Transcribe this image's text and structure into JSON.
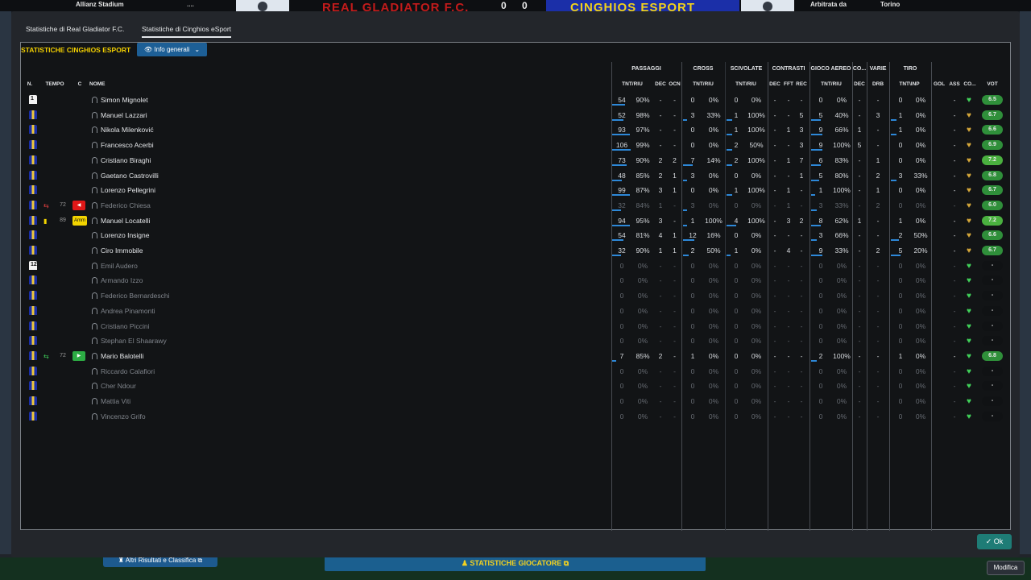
{
  "scoreboard": {
    "stadium": "Allianz Stadium",
    "home_name": "REAL GLADIATOR F.C.",
    "away_name": "CINGHIOS ESPORT",
    "home_score": "0",
    "away_score": "0",
    "ref_label": "Arbitrata da",
    "ref_city": "Torino",
    "hint": "...."
  },
  "tabs": [
    {
      "label": "Statistiche di Real Gladiator F.C."
    },
    {
      "label": "Statistiche di Cinghios eSport"
    }
  ],
  "panel": {
    "title": "STATISTICHE CINGHIOS ESPORT",
    "dropdown": "Info generali"
  },
  "group_headers": [
    "PASSAGGI",
    "CROSS",
    "SCIVOLATE",
    "CONTRASTI",
    "GIOCO AEREO",
    "CO...",
    "VARIE",
    "TIRO"
  ],
  "col_headers": {
    "num": "N.",
    "time": "TEMPO",
    "card": "C",
    "name": "NOME",
    "pass_tr": "TNT/RIU",
    "pass_dec": "DEC",
    "pass_ocn": "OCN",
    "cross_tr": "TNT/RIU",
    "sciv_tr": "TNT/RIU",
    "con_dec": "DEC",
    "con_fft": "FFT",
    "con_rec": "REC",
    "air_tr": "TNT/RIU",
    "co_dec": "DEC",
    "drb": "DRB",
    "tiro": "TNT\\INP",
    "gol": "GOL",
    "ass": "ASS",
    "cond": "CO...",
    "vot": "VOT"
  },
  "players": [
    {
      "name": "Simon Mignolet",
      "num": "1",
      "kit": "gk",
      "active": true,
      "cells": [
        "54",
        "90%",
        "-",
        "-",
        "0",
        "0%",
        "0",
        "0%",
        "-",
        "-",
        "-",
        "0",
        "0%",
        "-",
        "-",
        "0",
        "0%",
        "",
        "-"
      ],
      "bars": [
        0.65,
        0,
        0,
        0,
        0
      ],
      "heart": "green",
      "vote": "6.5"
    },
    {
      "name": "Manuel Lazzari",
      "num": "",
      "kit": "out",
      "active": true,
      "cells": [
        "52",
        "98%",
        "-",
        "-",
        "3",
        "33%",
        "1",
        "100%",
        "-",
        "-",
        "5",
        "5",
        "40%",
        "-",
        "3",
        "1",
        "0%",
        "",
        "-"
      ],
      "bars": [
        0.6,
        0.2,
        0.3,
        0.5,
        0.3
      ],
      "heart": "gold",
      "vote": "6.7"
    },
    {
      "name": "Nikola Milenković",
      "num": "",
      "kit": "out",
      "active": true,
      "cells": [
        "93",
        "97%",
        "-",
        "-",
        "0",
        "0%",
        "1",
        "100%",
        "-",
        "1",
        "3",
        "9",
        "66%",
        "1",
        "-",
        "1",
        "0%",
        "",
        "-"
      ],
      "bars": [
        0.9,
        0,
        0.3,
        0.6,
        0.3
      ],
      "heart": "gold",
      "vote": "6.6"
    },
    {
      "name": "Francesco Acerbi",
      "num": "",
      "kit": "out",
      "active": true,
      "cells": [
        "106",
        "99%",
        "-",
        "-",
        "0",
        "0%",
        "2",
        "50%",
        "-",
        "-",
        "3",
        "9",
        "100%",
        "5",
        "-",
        "0",
        "0%",
        "",
        "-"
      ],
      "bars": [
        0.95,
        0,
        0.3,
        0.6,
        0
      ],
      "heart": "gold",
      "vote": "6.9"
    },
    {
      "name": "Cristiano Biraghi",
      "num": "",
      "kit": "out",
      "active": true,
      "cells": [
        "73",
        "90%",
        "2",
        "2",
        "7",
        "14%",
        "2",
        "100%",
        "-",
        "1",
        "7",
        "6",
        "83%",
        "-",
        "1",
        "0",
        "0%",
        "",
        "-"
      ],
      "bars": [
        0.75,
        0.5,
        0.3,
        0.5,
        0
      ],
      "heart": "gold",
      "vote": "7.2"
    },
    {
      "name": "Gaetano Castrovilli",
      "num": "",
      "kit": "out",
      "active": true,
      "cells": [
        "48",
        "85%",
        "2",
        "1",
        "3",
        "0%",
        "0",
        "0%",
        "-",
        "-",
        "1",
        "5",
        "80%",
        "-",
        "2",
        "3",
        "33%",
        "",
        "-"
      ],
      "bars": [
        0.5,
        0.2,
        0,
        0.4,
        0.3
      ],
      "heart": "gold",
      "vote": "6.8"
    },
    {
      "name": "Lorenzo Pellegrini",
      "num": "",
      "kit": "out",
      "active": true,
      "cells": [
        "99",
        "87%",
        "3",
        "1",
        "0",
        "0%",
        "1",
        "100%",
        "-",
        "1",
        "-",
        "1",
        "100%",
        "-",
        "1",
        "0",
        "0%",
        "",
        "-"
      ],
      "bars": [
        0.9,
        0,
        0.3,
        0.2,
        0
      ],
      "heart": "gold",
      "vote": "6.7"
    },
    {
      "name": "Federico Chiesa",
      "num": "",
      "kit": "out",
      "active": false,
      "sub": "out",
      "minute": "72",
      "card": "red",
      "cells": [
        "32",
        "84%",
        "1",
        "-",
        "3",
        "0%",
        "0",
        "0%",
        "-",
        "1",
        "-",
        "3",
        "33%",
        "-",
        "2",
        "0",
        "0%",
        "",
        "-"
      ],
      "bars": [
        0.45,
        0.2,
        0,
        0.3,
        0
      ],
      "heart": "gold",
      "vote": "6.0"
    },
    {
      "name": "Manuel Locatelli",
      "num": "",
      "kit": "out",
      "active": true,
      "sub": "yellow",
      "minute": "89",
      "card": "amm",
      "cells": [
        "94",
        "95%",
        "3",
        "-",
        "1",
        "100%",
        "4",
        "100%",
        "-",
        "3",
        "2",
        "8",
        "62%",
        "1",
        "-",
        "1",
        "0%",
        "",
        "-"
      ],
      "bars": [
        0.9,
        0.2,
        0.5,
        0.5,
        0
      ],
      "heart": "gold",
      "vote": "7.2"
    },
    {
      "name": "Lorenzo Insigne",
      "num": "",
      "kit": "out",
      "active": true,
      "cells": [
        "54",
        "81%",
        "4",
        "1",
        "12",
        "16%",
        "0",
        "0%",
        "-",
        "-",
        "-",
        "3",
        "66%",
        "-",
        "-",
        "2",
        "50%",
        "",
        "-"
      ],
      "bars": [
        0.6,
        0.6,
        0,
        0.3,
        0.4
      ],
      "heart": "gold",
      "vote": "6.6"
    },
    {
      "name": "Ciro Immobile",
      "num": "",
      "kit": "out",
      "active": true,
      "cells": [
        "32",
        "90%",
        "1",
        "1",
        "2",
        "50%",
        "1",
        "0%",
        "-",
        "4",
        "-",
        "9",
        "33%",
        "-",
        "2",
        "5",
        "20%",
        "",
        "-"
      ],
      "bars": [
        0.45,
        0.3,
        0.2,
        0.6,
        0.5
      ],
      "heart": "gold",
      "vote": "6.7"
    },
    {
      "name": "Emil Audero",
      "num": "12",
      "kit": "gk",
      "active": false,
      "cells": [
        "0",
        "0%",
        "-",
        "-",
        "0",
        "0%",
        "0",
        "0%",
        "-",
        "-",
        "-",
        "0",
        "0%",
        "-",
        "-",
        "0",
        "0%",
        "",
        "-"
      ],
      "bars": [
        0,
        0,
        0,
        0,
        0
      ],
      "heart": "green",
      "vote": "-"
    },
    {
      "name": "Armando Izzo",
      "num": "",
      "kit": "out",
      "active": false,
      "cells": [
        "0",
        "0%",
        "-",
        "-",
        "0",
        "0%",
        "0",
        "0%",
        "-",
        "-",
        "-",
        "0",
        "0%",
        "-",
        "-",
        "0",
        "0%",
        "",
        "-"
      ],
      "bars": [
        0,
        0,
        0,
        0,
        0
      ],
      "heart": "green",
      "vote": "-"
    },
    {
      "name": "Federico Bernardeschi",
      "num": "",
      "kit": "out",
      "active": false,
      "cells": [
        "0",
        "0%",
        "-",
        "-",
        "0",
        "0%",
        "0",
        "0%",
        "-",
        "-",
        "-",
        "0",
        "0%",
        "-",
        "-",
        "0",
        "0%",
        "",
        "-"
      ],
      "bars": [
        0,
        0,
        0,
        0,
        0
      ],
      "heart": "green",
      "vote": "-"
    },
    {
      "name": "Andrea Pinamonti",
      "num": "",
      "kit": "out",
      "active": false,
      "cells": [
        "0",
        "0%",
        "-",
        "-",
        "0",
        "0%",
        "0",
        "0%",
        "-",
        "-",
        "-",
        "0",
        "0%",
        "-",
        "-",
        "0",
        "0%",
        "",
        "-"
      ],
      "bars": [
        0,
        0,
        0,
        0,
        0
      ],
      "heart": "green",
      "vote": "-"
    },
    {
      "name": "Cristiano Piccini",
      "num": "",
      "kit": "out",
      "active": false,
      "cells": [
        "0",
        "0%",
        "-",
        "-",
        "0",
        "0%",
        "0",
        "0%",
        "-",
        "-",
        "-",
        "0",
        "0%",
        "-",
        "-",
        "0",
        "0%",
        "",
        "-"
      ],
      "bars": [
        0,
        0,
        0,
        0,
        0
      ],
      "heart": "green",
      "vote": "-"
    },
    {
      "name": "Stephan El Shaarawy",
      "num": "",
      "kit": "out",
      "active": false,
      "cells": [
        "0",
        "0%",
        "-",
        "-",
        "0",
        "0%",
        "0",
        "0%",
        "-",
        "-",
        "-",
        "0",
        "0%",
        "-",
        "-",
        "0",
        "0%",
        "",
        "-"
      ],
      "bars": [
        0,
        0,
        0,
        0,
        0
      ],
      "heart": "green",
      "vote": "-"
    },
    {
      "name": "Mario Balotelli",
      "num": "",
      "kit": "out",
      "active": true,
      "sub": "in",
      "minute": "72",
      "card": "green",
      "cells": [
        "7",
        "85%",
        "2",
        "-",
        "1",
        "0%",
        "0",
        "0%",
        "-",
        "-",
        "-",
        "2",
        "100%",
        "-",
        "-",
        "1",
        "0%",
        "",
        "-"
      ],
      "bars": [
        0.2,
        0,
        0,
        0.3,
        0
      ],
      "heart": "green",
      "vote": "6.8"
    },
    {
      "name": "Riccardo Calafiori",
      "num": "",
      "kit": "out",
      "active": false,
      "cells": [
        "0",
        "0%",
        "-",
        "-",
        "0",
        "0%",
        "0",
        "0%",
        "-",
        "-",
        "-",
        "0",
        "0%",
        "-",
        "-",
        "0",
        "0%",
        "",
        "-"
      ],
      "bars": [
        0,
        0,
        0,
        0,
        0
      ],
      "heart": "green",
      "vote": "-"
    },
    {
      "name": "Cher Ndour",
      "num": "",
      "kit": "out",
      "active": false,
      "cells": [
        "0",
        "0%",
        "-",
        "-",
        "0",
        "0%",
        "0",
        "0%",
        "-",
        "-",
        "-",
        "0",
        "0%",
        "-",
        "-",
        "0",
        "0%",
        "",
        "-"
      ],
      "bars": [
        0,
        0,
        0,
        0,
        0
      ],
      "heart": "green",
      "vote": "-"
    },
    {
      "name": "Mattia Viti",
      "num": "",
      "kit": "out",
      "active": false,
      "cells": [
        "0",
        "0%",
        "-",
        "-",
        "0",
        "0%",
        "0",
        "0%",
        "-",
        "-",
        "-",
        "0",
        "0%",
        "-",
        "-",
        "0",
        "0%",
        "",
        "-"
      ],
      "bars": [
        0,
        0,
        0,
        0,
        0
      ],
      "heart": "green",
      "vote": "-"
    },
    {
      "name": "Vincenzo Grifo",
      "num": "",
      "kit": "out",
      "active": false,
      "cells": [
        "0",
        "0%",
        "-",
        "-",
        "0",
        "0%",
        "0",
        "0%",
        "-",
        "-",
        "-",
        "0",
        "0%",
        "-",
        "-",
        "0",
        "0%",
        "",
        "-"
      ],
      "bars": [
        0,
        0,
        0,
        0,
        0
      ],
      "heart": "green",
      "vote": "-"
    }
  ],
  "card_labels": {
    "amm": "Amm"
  },
  "buttons": {
    "ok": "Ok",
    "altri": "Altri Risultati e Classifica",
    "stat": "STATISTICHE GIOCATORE",
    "mod": "Modifica"
  },
  "colors": {
    "accent": "#1d5f96",
    "title": "#f3d000",
    "good": "#41d25a",
    "ok": "#1e7c76"
  }
}
